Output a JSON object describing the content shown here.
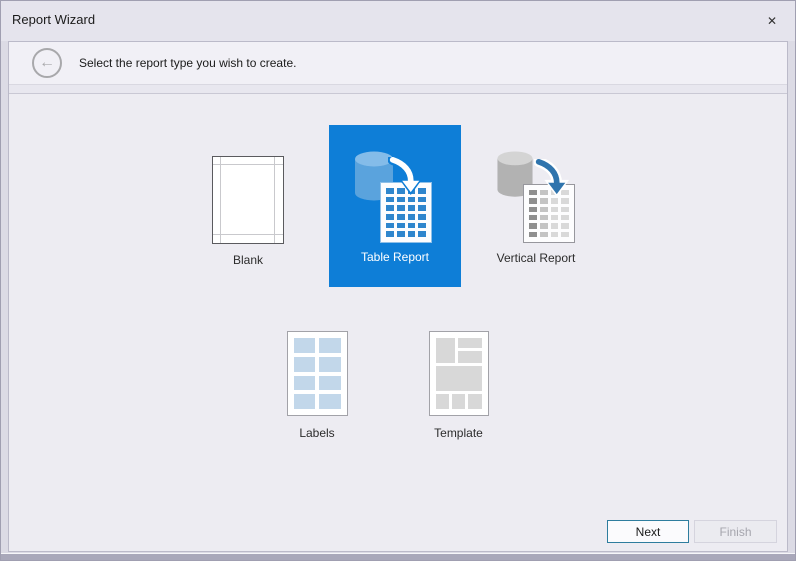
{
  "window": {
    "title": "Report Wizard",
    "close_icon": "✕"
  },
  "header": {
    "back_icon": "←",
    "instruction": "Select the report type you wish to create."
  },
  "options": {
    "blank": {
      "label": "Blank",
      "selected": false
    },
    "table": {
      "label": "Table Report",
      "selected": true
    },
    "vertical": {
      "label": "Vertical Report",
      "selected": false
    },
    "labels": {
      "label": "Labels",
      "selected": false
    },
    "template": {
      "label": "Template",
      "selected": false
    }
  },
  "footer": {
    "next_label": "Next",
    "finish_label": "Finish",
    "finish_enabled": false
  },
  "colors": {
    "selected_tile": "#0e7ed7",
    "selected_tile_text": "#ffffff",
    "table_cell_blue": "#2f86cd",
    "vertical_arrow_blue": "#2f74ad",
    "labels_cell_blue": "#c2d7ea",
    "template_cell_gray": "#d8d8d8",
    "next_button_border": "#2e7d9e",
    "disabled_text": "#a5a5ad",
    "titlebar_bg": "#e5e4ed",
    "content_bg": "#edecf2"
  }
}
